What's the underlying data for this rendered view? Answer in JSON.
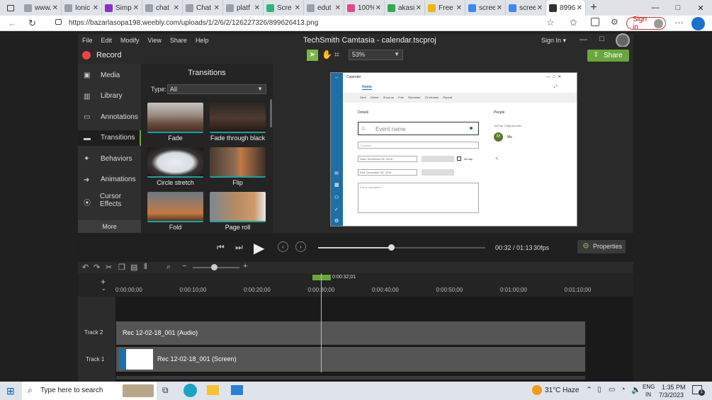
{
  "browser": {
    "tabs": [
      {
        "label": "www.",
        "color": "#9aa0a6"
      },
      {
        "label": "Ionic",
        "color": "#9aa0a6"
      },
      {
        "label": "Simp",
        "color": "#8e2ec9"
      },
      {
        "label": "chat",
        "color": "#9aa0a6"
      },
      {
        "label": "Chat",
        "color": "#9aa0a6"
      },
      {
        "label": "platf",
        "color": "#9aa0a6"
      },
      {
        "label": "Scre",
        "color": "#2db67c"
      },
      {
        "label": "edut",
        "color": "#9aa0a6"
      },
      {
        "label": "100%",
        "color": "#e04a8c"
      },
      {
        "label": "akasi",
        "color": "#35a853"
      },
      {
        "label": "Free",
        "color": "#f4b400"
      },
      {
        "label": "scree",
        "color": "#4285f4"
      },
      {
        "label": "scree",
        "color": "#4285f4"
      },
      {
        "label": "8996",
        "color": "#333333",
        "active": true
      }
    ],
    "url": "https://bazarlasopa198.weebly.com/uploads/1/2/6/2/126227326/899626413.png",
    "sign_in": "Sign in",
    "window_controls": {
      "min": "—",
      "max": "□",
      "close": "✕"
    }
  },
  "camtasia": {
    "menu": [
      "File",
      "Edit",
      "Modify",
      "View",
      "Share",
      "Help"
    ],
    "title": "TechSmith Camtasia - calendar.tscproj",
    "sign_in": "Sign In ▾",
    "record_label": "Record",
    "zoom": "53%",
    "share_label": "Share",
    "sidebar": [
      {
        "label": "Media",
        "icon": "▣"
      },
      {
        "label": "Library",
        "icon": "▥"
      },
      {
        "label": "Annotations",
        "icon": "▭"
      },
      {
        "label": "Transitions",
        "icon": "▬"
      },
      {
        "label": "Behaviors",
        "icon": "✦"
      },
      {
        "label": "Animations",
        "icon": "➜"
      },
      {
        "label": "Cursor Effects",
        "icon": "⦿"
      }
    ],
    "more_label": "More",
    "panel": {
      "title": "Transitions",
      "type_label": "Type:",
      "type_value": "All",
      "items": [
        "Fade",
        "Fade through black",
        "Circle stretch",
        "Flip",
        "Fold",
        "Page roll"
      ]
    },
    "preview": {
      "app_title": "Calendar",
      "home_tab": "Home",
      "toolbar": [
        "Save",
        "Delete",
        "Show as",
        "Free",
        "Reminder",
        "15 minutes",
        "Repeat"
      ],
      "details_label": "Details",
      "people_label": "People",
      "event_name_placeholder": "Event name",
      "location_placeholder": "Location",
      "start_label": "Start: December 06, 2018",
      "end_label": "End: December 06, 2018",
      "all_day": "All day",
      "description_placeholder": "Event description",
      "sort_by": "Sort by: Original order",
      "person_initial": "M",
      "person_name": "Me"
    },
    "playback": {
      "time": "00:32 / 01:13",
      "fps": "30fps",
      "properties": "Properties",
      "progress": 0.438
    },
    "timeline": {
      "playhead_time": "0:00:32;01",
      "ticks": [
        "0:00:00;00",
        "0:00:10;00",
        "0:00:20;00",
        "0:00:30;00",
        "0:00:40;00",
        "0:00:50;00",
        "0:01:00;00",
        "0:01:10;00"
      ],
      "tracks": [
        {
          "label": "Track 2",
          "clip": "Rec 12-02-18_001 (Audio)"
        },
        {
          "label": "Track 1",
          "clip": "Rec 12-02-18_001 (Screen)"
        }
      ]
    }
  },
  "taskbar": {
    "search_placeholder": "Type here to search",
    "weather": "31°C Haze",
    "lang": "ENG",
    "region": "IN",
    "time": "1:35 PM",
    "date": "7/3/2023",
    "notification_count": "1"
  }
}
